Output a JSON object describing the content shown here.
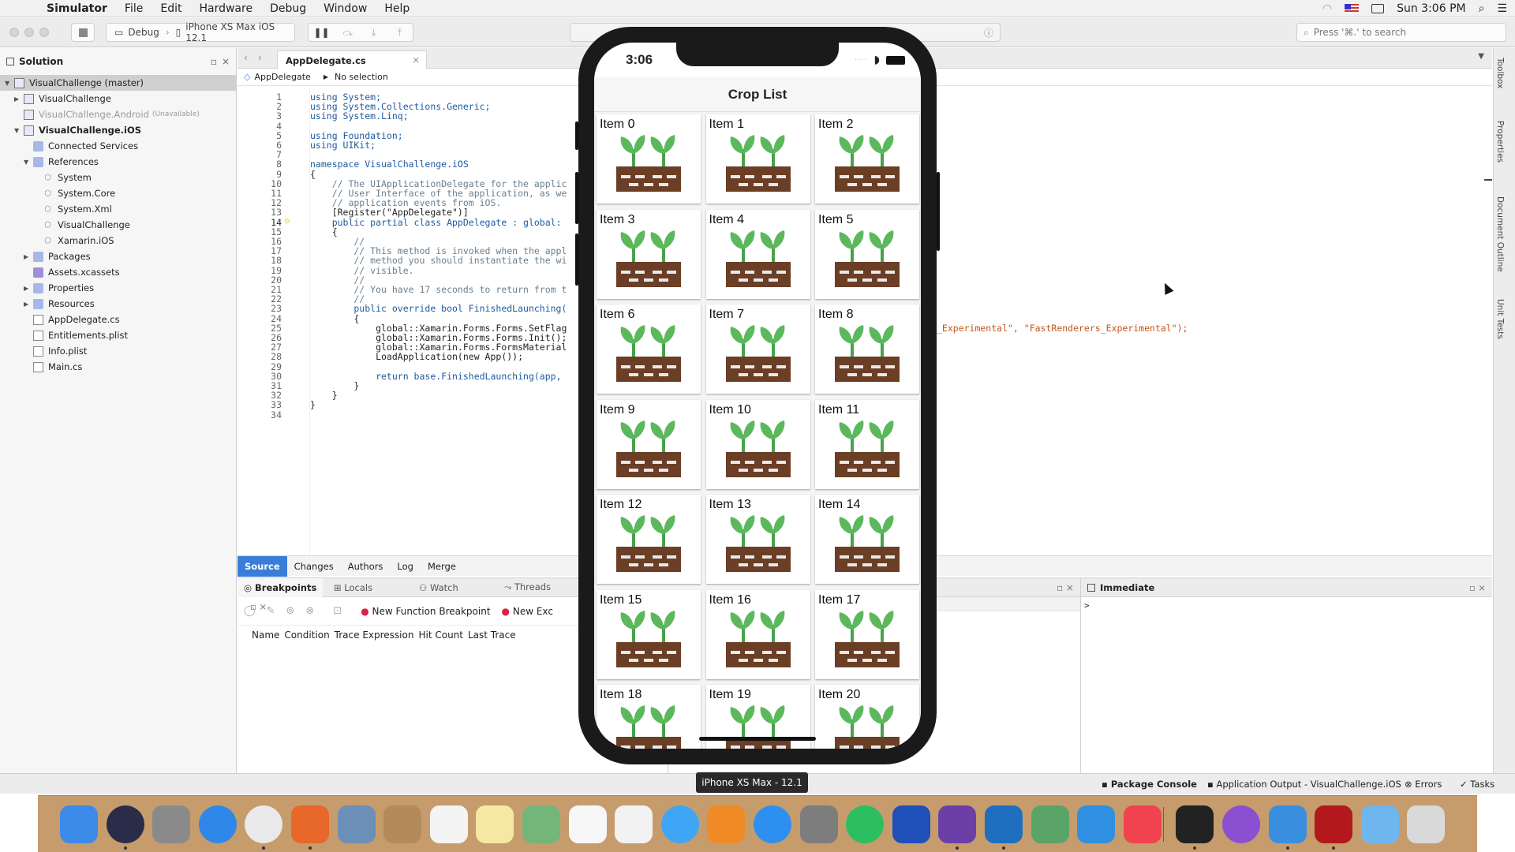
{
  "menubar": {
    "app": "Simulator",
    "items": [
      "File",
      "Edit",
      "Hardware",
      "Debug",
      "Window",
      "Help"
    ],
    "clock": "Sun 3:06 PM"
  },
  "toolbar": {
    "config": "Debug",
    "device": "iPhone XS Max iOS 12.1",
    "search_placeholder": "Press '⌘.' to search"
  },
  "solution": {
    "title": "Solution",
    "rows": [
      {
        "label": "VisualChallenge (master)",
        "indent": 0,
        "arrow": "▼",
        "icon": "solution-icon",
        "selected": true
      },
      {
        "label": "VisualChallenge",
        "indent": 1,
        "arrow": "▶",
        "icon": "project-icon"
      },
      {
        "label": "VisualChallenge.Android",
        "suffix": "(Unavailable)",
        "indent": 1,
        "arrow": "",
        "icon": "project-icon",
        "dim": true
      },
      {
        "label": "VisualChallenge.iOS",
        "indent": 1,
        "arrow": "▼",
        "icon": "project-icon",
        "bold": true
      },
      {
        "label": "Connected Services",
        "indent": 2,
        "arrow": "",
        "icon": "folder-icon"
      },
      {
        "label": "References",
        "indent": 2,
        "arrow": "▼",
        "icon": "folder-icon"
      },
      {
        "label": "System",
        "indent": 3,
        "arrow": "",
        "icon": "reference-icon"
      },
      {
        "label": "System.Core",
        "indent": 3,
        "arrow": "",
        "icon": "reference-icon"
      },
      {
        "label": "System.Xml",
        "indent": 3,
        "arrow": "",
        "icon": "reference-icon"
      },
      {
        "label": "VisualChallenge",
        "indent": 3,
        "arrow": "",
        "icon": "reference-icon"
      },
      {
        "label": "Xamarin.iOS",
        "indent": 3,
        "arrow": "",
        "icon": "reference-icon"
      },
      {
        "label": "Packages",
        "indent": 2,
        "arrow": "▶",
        "icon": "folder-icon"
      },
      {
        "label": "Assets.xcassets",
        "indent": 2,
        "arrow": "",
        "icon": "assets-icon"
      },
      {
        "label": "Properties",
        "indent": 2,
        "arrow": "▶",
        "icon": "folder-icon"
      },
      {
        "label": "Resources",
        "indent": 2,
        "arrow": "▶",
        "icon": "folder-icon"
      },
      {
        "label": "AppDelegate.cs",
        "indent": 2,
        "arrow": "",
        "icon": "file-icon"
      },
      {
        "label": "Entitlements.plist",
        "indent": 2,
        "arrow": "",
        "icon": "file-icon"
      },
      {
        "label": "Info.plist",
        "indent": 2,
        "arrow": "",
        "icon": "file-icon"
      },
      {
        "label": "Main.cs",
        "indent": 2,
        "arrow": "",
        "icon": "file-icon"
      }
    ]
  },
  "editor": {
    "tab": "AppDelegate.cs",
    "breadcrumb_class": "AppDelegate",
    "breadcrumb_member": "No selection",
    "lines": [
      "using System;",
      "using System.Collections.Generic;",
      "using System.Linq;",
      "",
      "using Foundation;",
      "using UIKit;",
      "",
      "namespace VisualChallenge.iOS",
      "{",
      "    // The UIApplicationDelegate for the applic",
      "    // User Interface of the application, as we",
      "    // application events from iOS.",
      "    [Register(\"AppDelegate\")]",
      "    public partial class AppDelegate : global:",
      "    {",
      "        //",
      "        // This method is invoked when the appl",
      "        // method you should instantiate the wi",
      "        // visible.",
      "        //",
      "        // You have 17 seconds to return from t",
      "        //",
      "        public override bool FinishedLaunching(",
      "        {",
      "            global::Xamarin.Forms.Forms.SetFlag",
      "            global::Xamarin.Forms.Forms.Init();",
      "            global::Xamarin.Forms.FormsMaterial",
      "            LoadApplication(new App());",
      "",
      "            return base.FinishedLaunching(app, ",
      "        }",
      "    }",
      "}",
      ""
    ],
    "line25_tail": "_Experimental\", \"FastRenderers_Experimental\");"
  },
  "bottom_tabs": [
    "Source",
    "Changes",
    "Authors",
    "Log",
    "Merge"
  ],
  "breakpoints": {
    "tabs": [
      "Breakpoints",
      "Locals",
      "Watch",
      "Threads"
    ],
    "new_function": "New Function Breakpoint",
    "new_exception": "New Exc",
    "columns": [
      "Name",
      "Condition",
      "Trace Expression",
      "Hit Count",
      "Last Trace"
    ]
  },
  "immediate": {
    "title": "Immediate",
    "prompt": ">"
  },
  "right_tabs": [
    "Toolbox",
    "Properties",
    "Document Outline",
    "Unit Tests"
  ],
  "status": {
    "device_tooltip": "iPhone XS Max - 12.1",
    "package_console": "Package Console",
    "app_output": "Application Output - VisualChallenge.iOS",
    "errors": "Errors",
    "tasks": "Tasks"
  },
  "phone": {
    "time": "3:06",
    "nav_title": "Crop List",
    "items": [
      "Item 0",
      "Item 1",
      "Item 2",
      "Item 3",
      "Item 4",
      "Item 5",
      "Item 6",
      "Item 7",
      "Item 8",
      "Item 9",
      "Item 10",
      "Item 11",
      "Item 12",
      "Item 13",
      "Item 14",
      "Item 15",
      "Item 16",
      "Item 17",
      "Item 18",
      "Item 19",
      "Item 20"
    ]
  },
  "dock": {
    "apps": [
      {
        "name": "finder",
        "color": "#3d8be8"
      },
      {
        "name": "siri",
        "color": "#2b2b4a"
      },
      {
        "name": "launchpad",
        "color": "#8a8a8a"
      },
      {
        "name": "safari",
        "color": "#2f87e8"
      },
      {
        "name": "chrome",
        "color": "#e9e9e9"
      },
      {
        "name": "firefox",
        "color": "#e8672a"
      },
      {
        "name": "preview",
        "color": "#6b8fb7"
      },
      {
        "name": "contacts",
        "color": "#b58a5a"
      },
      {
        "name": "calendar",
        "color": "#f4f4f4"
      },
      {
        "name": "notes",
        "color": "#f6e7a2"
      },
      {
        "name": "maps",
        "color": "#74b57a"
      },
      {
        "name": "reminders",
        "color": "#f7f7f7"
      },
      {
        "name": "photos",
        "color": "#f2f2f2"
      },
      {
        "name": "messages",
        "color": "#3fa6f5"
      },
      {
        "name": "books",
        "color": "#f08a24"
      },
      {
        "name": "app-store",
        "color": "#2d8ff0"
      },
      {
        "name": "system-preferences",
        "color": "#7d7d7d"
      },
      {
        "name": "evernote",
        "color": "#2dbe60"
      },
      {
        "name": "dropbox",
        "color": "#1f4fb8"
      },
      {
        "name": "visual-studio",
        "color": "#6c3fa6"
      },
      {
        "name": "vscode",
        "color": "#1e6fc0"
      },
      {
        "name": "android-studio",
        "color": "#5aa468"
      },
      {
        "name": "xcode",
        "color": "#2f8fe0"
      },
      {
        "name": "news",
        "color": "#f1424f"
      },
      {
        "name": "terminal",
        "color": "#222222"
      },
      {
        "name": "sync",
        "color": "#8b4fd1"
      },
      {
        "name": "simulator",
        "color": "#3a8ee0"
      },
      {
        "name": "acrobat",
        "color": "#b3181c"
      },
      {
        "name": "downloads",
        "color": "#70b6ee"
      },
      {
        "name": "trash",
        "color": "#d9d9d9"
      }
    ]
  }
}
